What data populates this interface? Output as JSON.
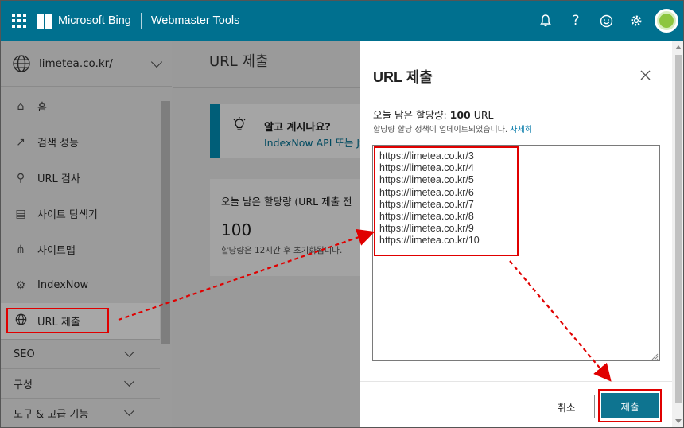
{
  "topbar": {
    "brand": "Microsoft Bing",
    "product": "Webmaster Tools",
    "icons": [
      "bell-icon",
      "help-icon",
      "smiley-icon",
      "gear-icon"
    ],
    "color": "#00708f"
  },
  "sidebar": {
    "site": "limetea.co.kr/",
    "items": [
      {
        "label": "홈",
        "icon": "home-icon"
      },
      {
        "label": "검색 성능",
        "icon": "trend-icon"
      },
      {
        "label": "URL 검사",
        "icon": "search-icon"
      },
      {
        "label": "사이트 탐색기",
        "icon": "document-icon"
      },
      {
        "label": "사이트맵",
        "icon": "sitemap-icon"
      },
      {
        "label": "IndexNow",
        "icon": "gear-icon"
      },
      {
        "label": "URL 제출",
        "icon": "globe-icon",
        "active": true
      }
    ],
    "groups": [
      "SEO",
      "구성",
      "도구 & 고급 기능"
    ]
  },
  "main": {
    "title": "URL 제출",
    "banner": {
      "title": "알고 계시나요?",
      "text": "IndexNow API 또는 JS"
    },
    "card": {
      "title": "오늘 남은 할당량 (URL 제출 전",
      "value": "100",
      "note": "할당량은 12시간 후 초기화됩니다."
    }
  },
  "dialog": {
    "title": "URL 제출",
    "quota_prefix": "오늘 남은 할당량: ",
    "quota_value": "100",
    "quota_suffix": " URL",
    "policy_text": "할당량 할당 정책이 업데이트되었습니다. ",
    "policy_link": "자세히",
    "urls": "https://limetea.co.kr/3\nhttps://limetea.co.kr/4\nhttps://limetea.co.kr/5\nhttps://limetea.co.kr/6\nhttps://limetea.co.kr/7\nhttps://limetea.co.kr/8\nhttps://limetea.co.kr/9\nhttps://limetea.co.kr/10",
    "cancel_label": "취소",
    "submit_label": "제출",
    "accent": "#0e7490"
  },
  "annotation_color": "#e00000"
}
